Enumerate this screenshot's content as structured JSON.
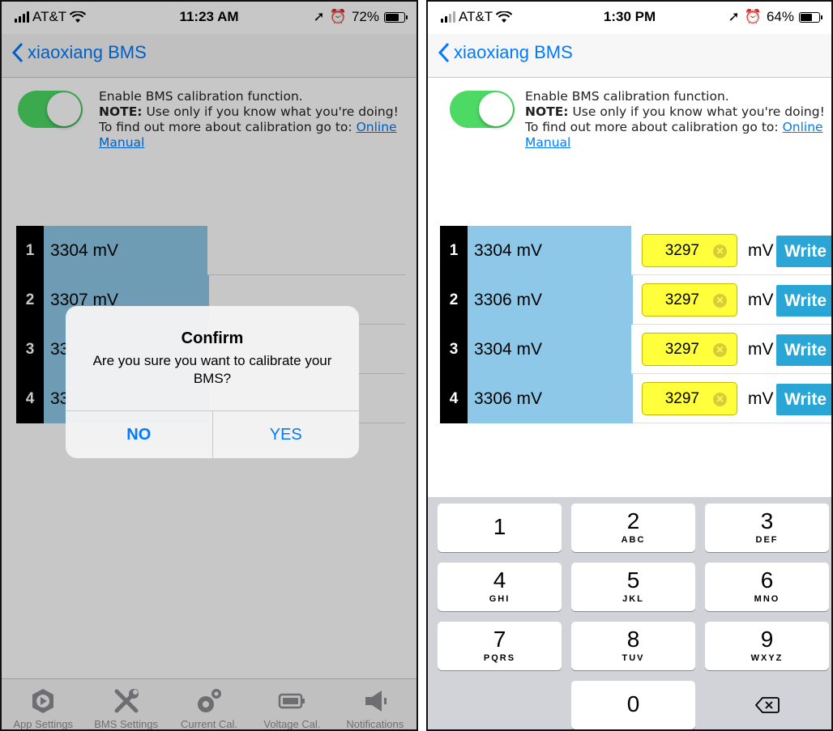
{
  "left": {
    "status": {
      "carrier": "AT&T",
      "time": "11:23 AM",
      "battery": "72%",
      "battery_level": 0.72
    },
    "nav": {
      "back_label": "xiaoxiang BMS"
    },
    "calibration": {
      "enable_text": "Enable BMS calibration function.",
      "note_label": "NOTE:",
      "note_text": "Use only if you know what you're doing! To find out more about calibration go to:",
      "link_text": "Online Manual"
    },
    "cells": [
      {
        "num": "1",
        "value": "3304 mV"
      },
      {
        "num": "2",
        "value": "3307 mV"
      },
      {
        "num": "3",
        "value": "33"
      },
      {
        "num": "4",
        "value": "33"
      }
    ],
    "dialog": {
      "title": "Confirm",
      "message": "Are you sure you want to calibrate your BMS?",
      "no": "NO",
      "yes": "YES"
    },
    "tabs": [
      {
        "label": "App Settings",
        "icon": "app-settings-icon"
      },
      {
        "label": "BMS Settings",
        "icon": "wrench-screwdriver-icon"
      },
      {
        "label": "Current Cal.",
        "icon": "gears-icon"
      },
      {
        "label": "Voltage Cal.",
        "icon": "battery-icon"
      },
      {
        "label": "Notifications",
        "icon": "megaphone-icon"
      }
    ]
  },
  "right": {
    "status": {
      "carrier": "AT&T",
      "time": "1:30 PM",
      "battery": "64%",
      "battery_level": 0.64
    },
    "nav": {
      "back_label": "xiaoxiang BMS"
    },
    "calibration": {
      "enable_text": "Enable BMS calibration function.",
      "note_label": "NOTE:",
      "note_text": "Use only if you know what you're doing! To find out more about calibration go to:",
      "link_text": "Online Manual"
    },
    "cells": [
      {
        "num": "1",
        "value": "3304 mV",
        "input": "3297",
        "unit": "mV",
        "button": "Write"
      },
      {
        "num": "2",
        "value": "3306 mV",
        "input": "3297",
        "unit": "mV",
        "button": "Write"
      },
      {
        "num": "3",
        "value": "3304 mV",
        "input": "3297",
        "unit": "mV",
        "button": "Write"
      },
      {
        "num": "4",
        "value": "3306 mV",
        "input": "3297",
        "unit": "mV",
        "button": "Write"
      }
    ],
    "keypad": [
      {
        "digit": "1",
        "letters": ""
      },
      {
        "digit": "2",
        "letters": "ABC"
      },
      {
        "digit": "3",
        "letters": "DEF"
      },
      {
        "digit": "4",
        "letters": "GHI"
      },
      {
        "digit": "5",
        "letters": "JKL"
      },
      {
        "digit": "6",
        "letters": "MNO"
      },
      {
        "digit": "7",
        "letters": "PQRS"
      },
      {
        "digit": "8",
        "letters": "TUV"
      },
      {
        "digit": "9",
        "letters": "WXYZ"
      },
      {
        "digit": "0",
        "letters": ""
      }
    ],
    "delete_key": "delete-icon"
  }
}
